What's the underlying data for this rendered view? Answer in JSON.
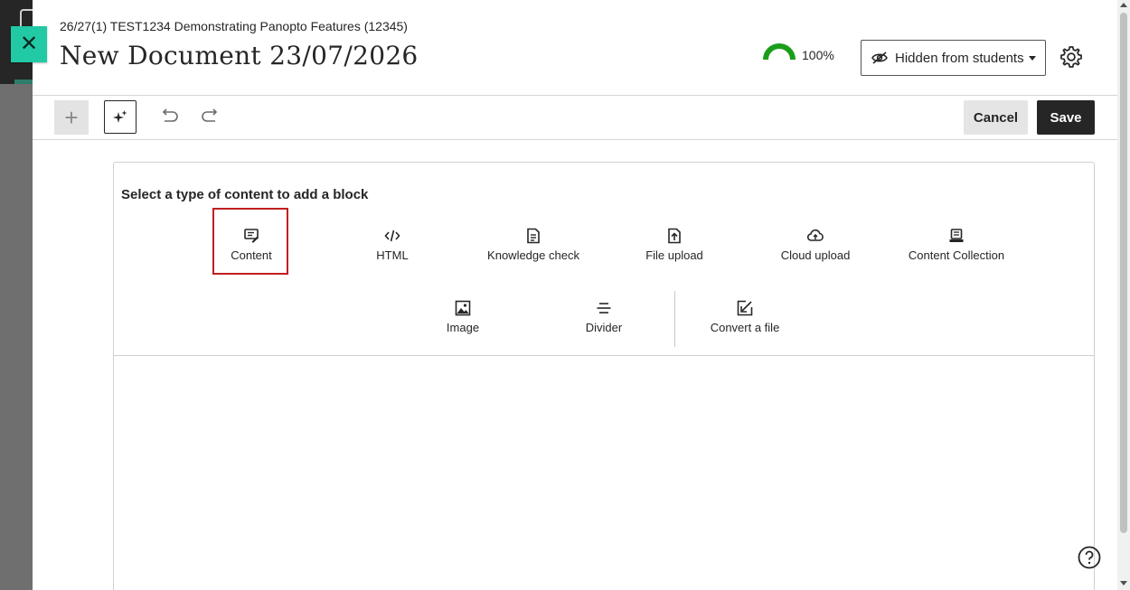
{
  "header": {
    "close_label": "✕",
    "breadcrumb": "26/27(1) TEST1234 Demonstrating Panopto Features (12345)",
    "title": "New Document 23/07/2026",
    "progress_percent": 100,
    "progress_label": "100%",
    "visibility_label": "Hidden from students"
  },
  "toolbar": {
    "add_label": "+",
    "cancel_label": "Cancel",
    "save_label": "Save"
  },
  "editor": {
    "prompt": "Select a type of content to add a block",
    "options_row1": [
      {
        "label": "Content",
        "icon": "content-icon"
      },
      {
        "label": "HTML",
        "icon": "html-code-icon"
      },
      {
        "label": "Knowledge check",
        "icon": "knowledge-check-icon"
      },
      {
        "label": "File upload",
        "icon": "file-upload-icon"
      },
      {
        "label": "Cloud upload",
        "icon": "cloud-upload-icon"
      },
      {
        "label": "Content Collection",
        "icon": "content-collection-icon"
      }
    ],
    "options_row2": [
      {
        "label": "Image",
        "icon": "image-icon"
      },
      {
        "label": "Divider",
        "icon": "divider-icon"
      },
      {
        "label": "Convert a file",
        "icon": "convert-file-icon"
      }
    ]
  },
  "colors": {
    "accent": "#21c9a5",
    "progress": "#1a9e1a",
    "highlight": "#c01f1f",
    "save_bg": "#262626"
  }
}
